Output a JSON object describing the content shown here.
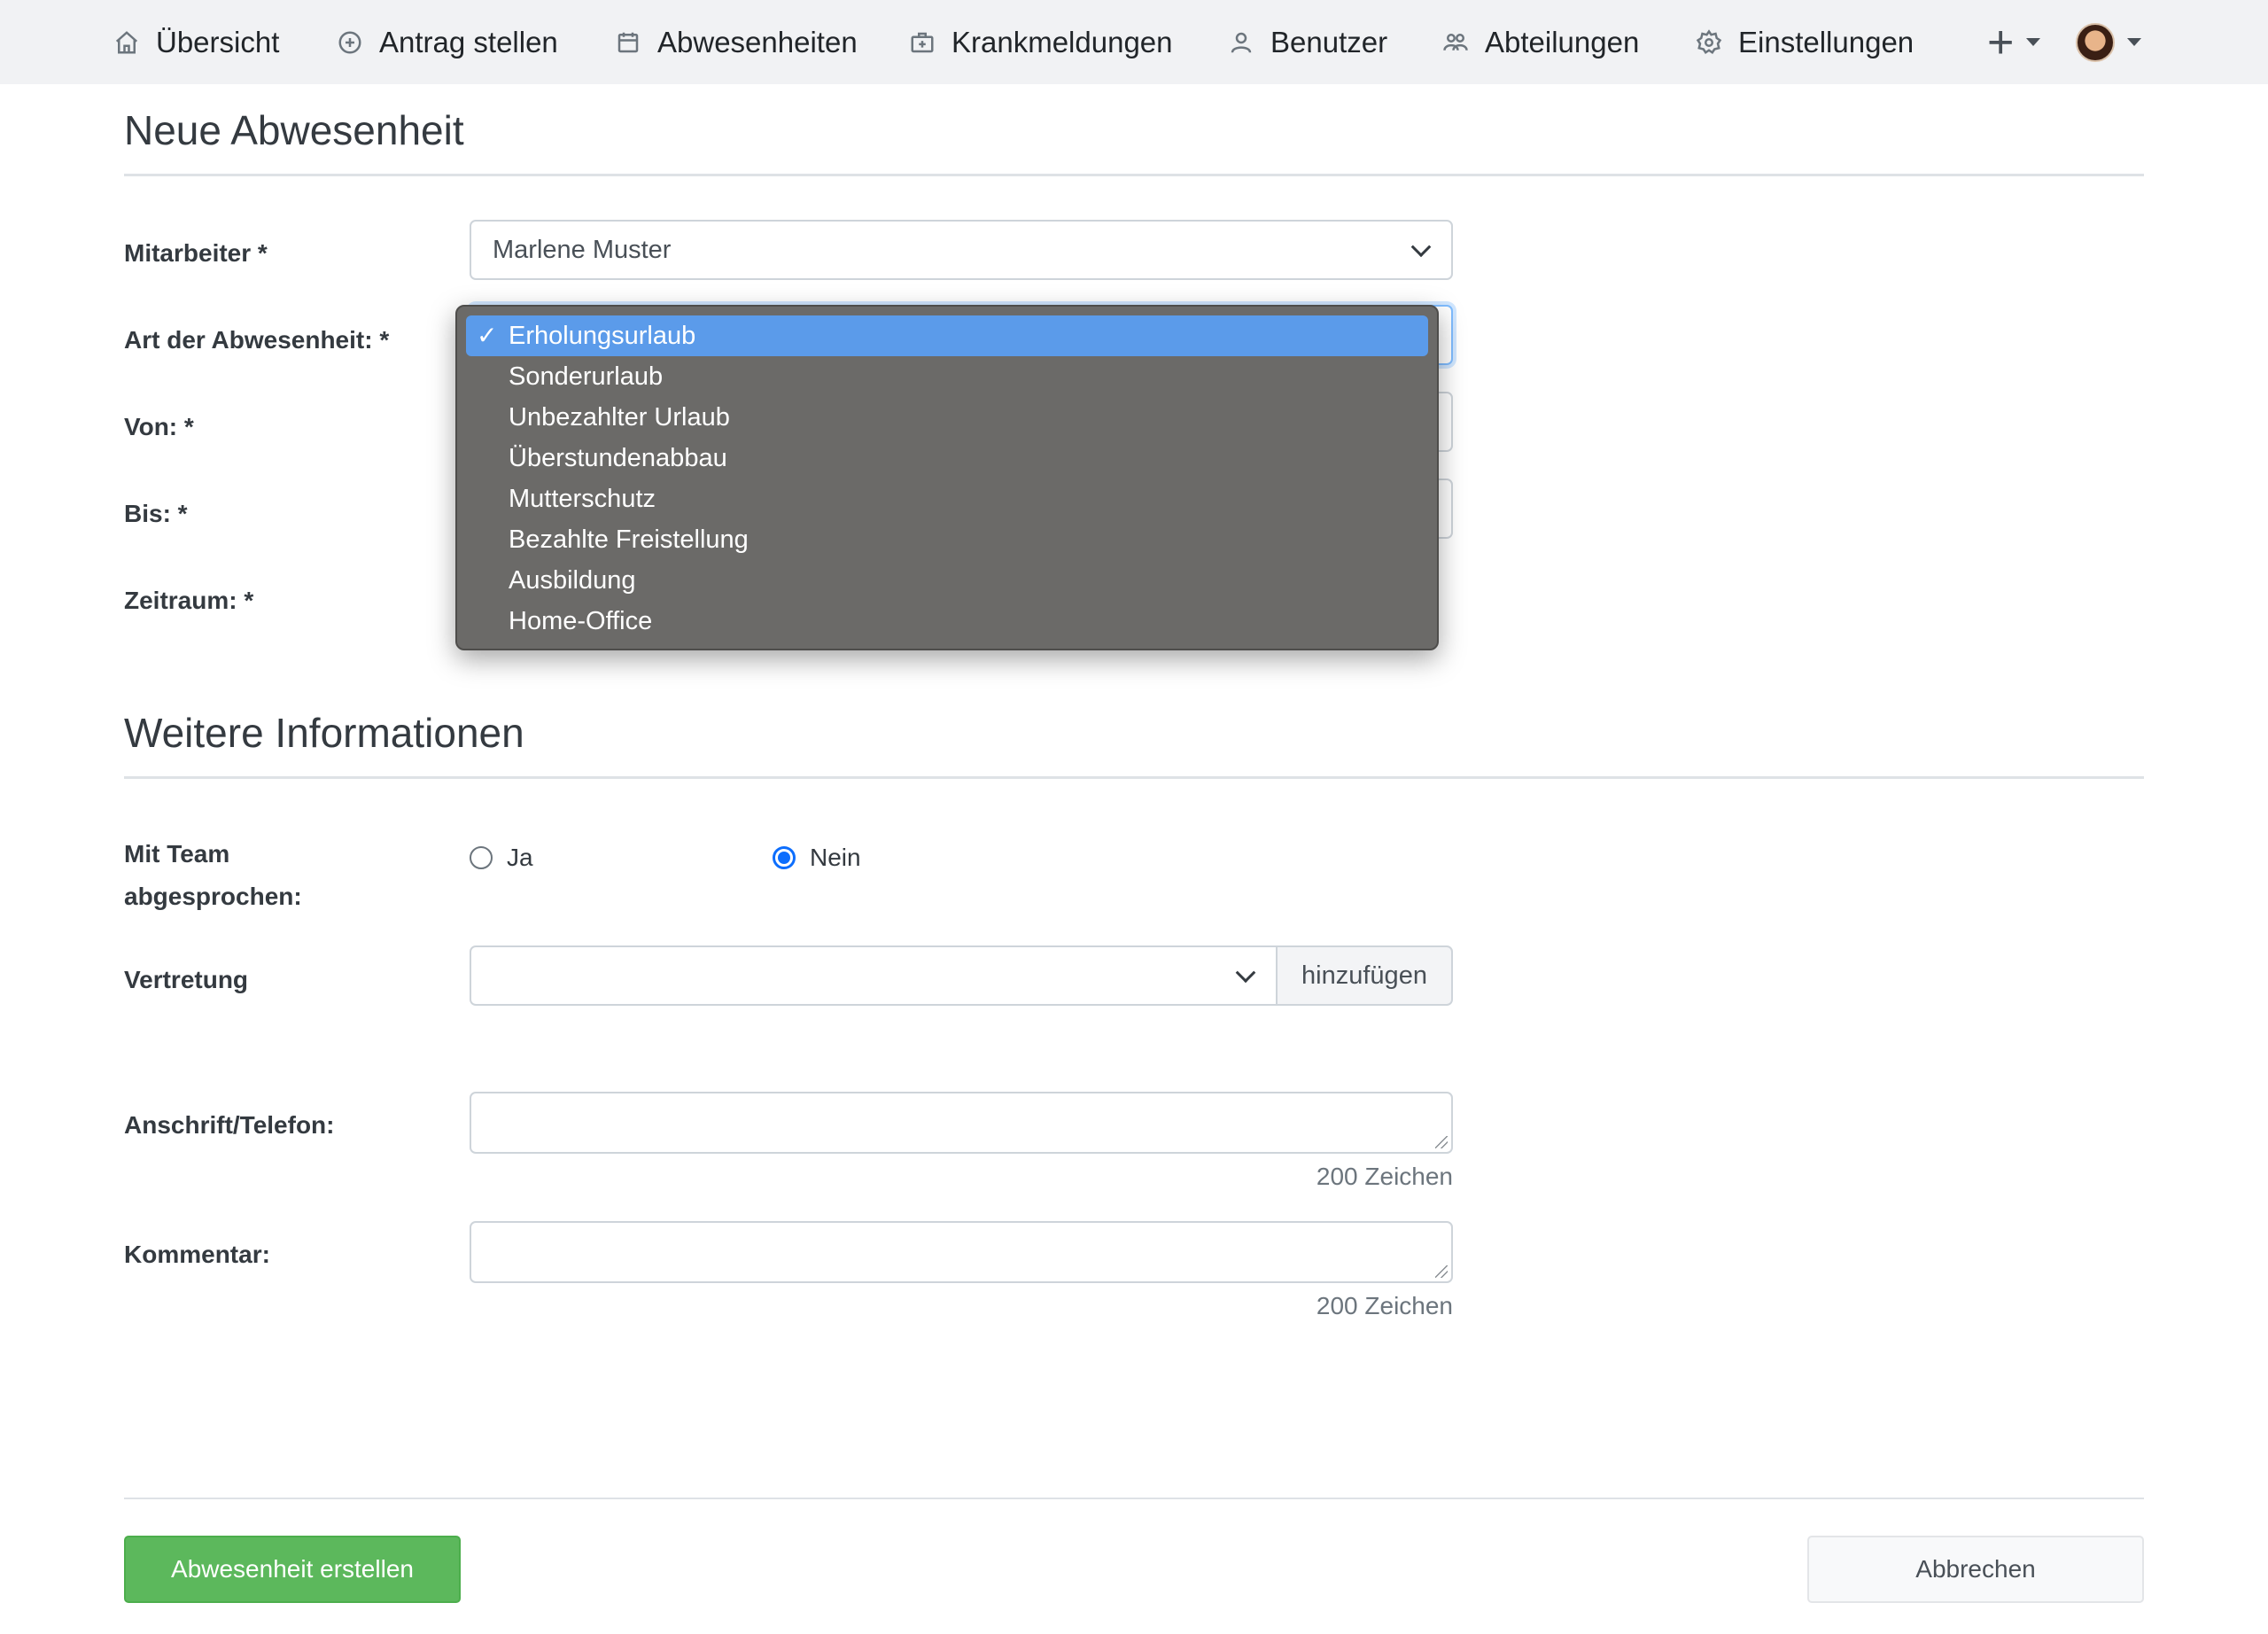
{
  "nav": {
    "items": [
      {
        "label": "Übersicht",
        "icon": "home-icon"
      },
      {
        "label": "Antrag stellen",
        "icon": "plus-circle-icon"
      },
      {
        "label": "Abwesenheiten",
        "icon": "calendar-icon"
      },
      {
        "label": "Krankmeldungen",
        "icon": "medical-case-icon"
      },
      {
        "label": "Benutzer",
        "icon": "user-icon"
      },
      {
        "label": "Abteilungen",
        "icon": "users-icon"
      },
      {
        "label": "Einstellungen",
        "icon": "gear-icon"
      }
    ],
    "plus_symbol": "+"
  },
  "form": {
    "title": "Neue Abwesenheit",
    "mitarbeiter_label": "Mitarbeiter *",
    "mitarbeiter_value": "Marlene Muster",
    "art_label": "Art der Abwesenheit: *",
    "von_label": "Von: *",
    "bis_label": "Bis: *",
    "zeitraum_label": "Zeitraum: *"
  },
  "dropdown": {
    "check": "✓",
    "selected_index": 0,
    "options": [
      "Erholungsurlaub",
      "Sonderurlaub",
      "Unbezahlter Urlaub",
      "Überstundenabbau",
      "Mutterschutz",
      "Bezahlte Freistellung",
      "Ausbildung",
      "Home-Office"
    ]
  },
  "info": {
    "title": "Weitere Informationen",
    "team_label_line1": "Mit Team",
    "team_label_line2": "abgesprochen:",
    "radio_ja": "Ja",
    "radio_nein": "Nein",
    "radio_selected": "Nein",
    "vertretung_label": "Vertretung",
    "vertretung_add": "hinzufügen",
    "anschrift_label": "Anschrift/Telefon:",
    "anschrift_counter": "200 Zeichen",
    "kommentar_label": "Kommentar:",
    "kommentar_counter": "200 Zeichen"
  },
  "actions": {
    "submit": "Abwesenheit erstellen",
    "cancel": "Abbrechen"
  },
  "colors": {
    "navbar_bg": "#f1f2f4",
    "primary_button": "#5cb85c",
    "dropdown_bg": "#6b6a68",
    "dropdown_selected": "#5b9bea",
    "radio_checked": "#0d6efd"
  }
}
